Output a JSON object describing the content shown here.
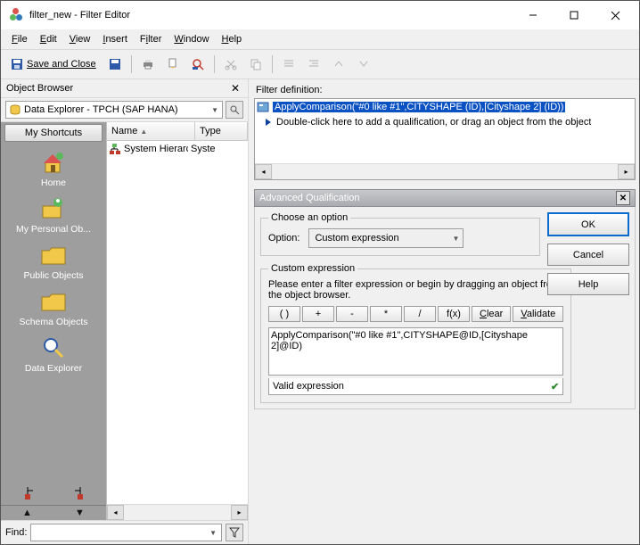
{
  "titlebar": {
    "title": "filter_new - Filter Editor"
  },
  "menu": {
    "file": "File",
    "edit": "Edit",
    "view": "View",
    "insert": "Insert",
    "filter": "Filter",
    "window": "Window",
    "help": "Help"
  },
  "toolbar": {
    "save_close": "Save and Close"
  },
  "object_browser": {
    "heading": "Object Browser",
    "combo": "Data Explorer - TPCH (SAP HANA)",
    "shortcuts_head": "My Shortcuts",
    "items": [
      {
        "label": "Home",
        "icon": "home"
      },
      {
        "label": "My Personal Ob...",
        "icon": "personal"
      },
      {
        "label": "Public Objects",
        "icon": "folder"
      },
      {
        "label": "Schema Objects",
        "icon": "folder"
      },
      {
        "label": "Data Explorer",
        "icon": "search"
      }
    ],
    "list": {
      "col_name": "Name",
      "col_type": "Type",
      "rows": [
        {
          "name": "System Hierarchy",
          "type": "Syste"
        }
      ]
    }
  },
  "find": {
    "label": "Find:",
    "value": ""
  },
  "filterdef": {
    "label": "Filter definition:",
    "sel": "ApplyComparison(\"#0 like #1\",CITYSHAPE (ID),[Cityshape 2] (ID))",
    "hint": "Double-click here to add a qualification, or drag an object from the object"
  },
  "adv": {
    "title": "Advanced Qualification",
    "choose": "Choose an option",
    "option_label": "Option:",
    "option_value": "Custom expression",
    "custom_title": "Custom expression",
    "custom_hint": "Please enter a filter expression or begin by dragging an object from the object browser.",
    "btns": {
      "lp": "( )",
      "plus": "+",
      "minus": "-",
      "mul": "*",
      "div": "/",
      "fx": "f(x)",
      "clear": "Clear",
      "validate": "Validate"
    },
    "expr": "ApplyComparison(\"#0 like #1\",CITYSHAPE@ID,[Cityshape 2]@ID)",
    "valid": "Valid expression",
    "ok": "OK",
    "cancel": "Cancel",
    "help": "Help"
  }
}
